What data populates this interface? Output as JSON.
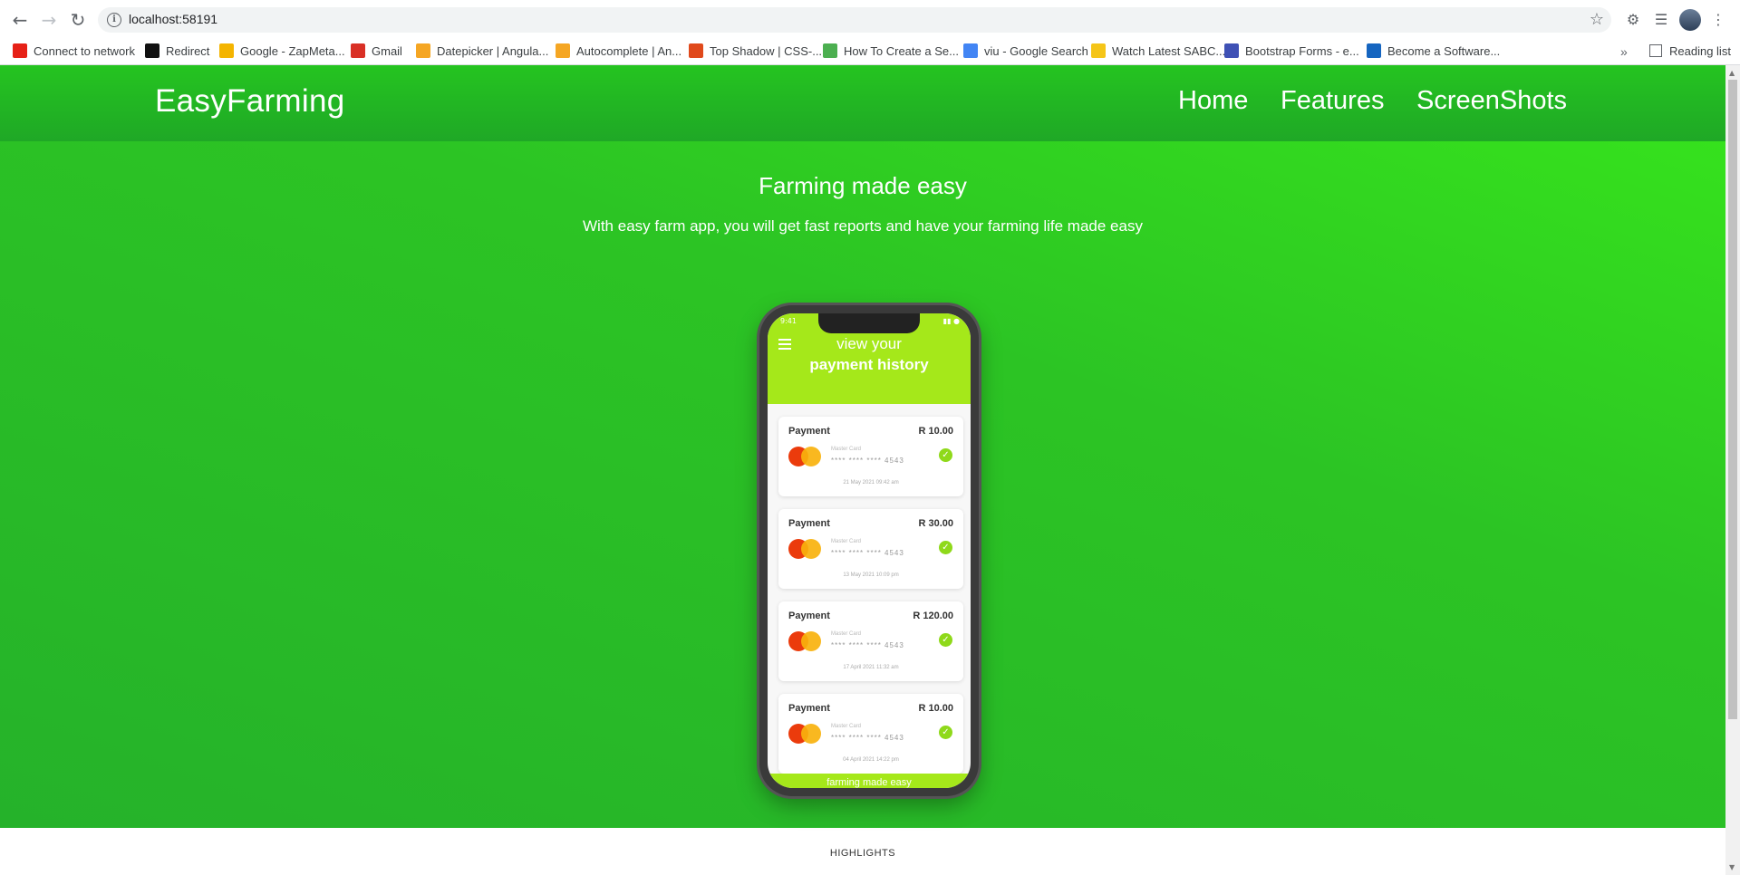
{
  "browser": {
    "url": "localhost:58191",
    "bookmarks": [
      {
        "label": "Connect to network",
        "color": "#e62117"
      },
      {
        "label": "Redirect",
        "color": "#111111"
      },
      {
        "label": "Google - ZapMeta...",
        "color": "#f4b400"
      },
      {
        "label": "Gmail",
        "color": "#d93025"
      },
      {
        "label": "Datepicker | Angula...",
        "color": "#f5a623"
      },
      {
        "label": "Autocomplete | An...",
        "color": "#f5a623"
      },
      {
        "label": "Top Shadow | CSS-...",
        "color": "#e0491b"
      },
      {
        "label": "How To Create a Se...",
        "color": "#4caf50"
      },
      {
        "label": "viu - Google Search",
        "color": "#4285f4"
      },
      {
        "label": "Watch Latest SABC...",
        "color": "#f5c518"
      },
      {
        "label": "Bootstrap Forms - e...",
        "color": "#3f51b5"
      },
      {
        "label": "Become a Software...",
        "color": "#1565c0"
      }
    ],
    "more_label": "»",
    "reading_list": "Reading list"
  },
  "navbar": {
    "brand": "EasyFarming",
    "links": [
      "Home",
      "Features",
      "ScreenShots"
    ]
  },
  "hero": {
    "headline": "Farming made easy",
    "subline": "With easy farm app, you will get fast reports and have your farming life made easy"
  },
  "phone": {
    "status_time": "9:41",
    "title_line1": "view your",
    "title_line2": "payment history",
    "footer": "farming made easy",
    "payments": [
      {
        "label": "Payment",
        "amount": "R 10.00",
        "card_type": "Master Card",
        "card_num": "****  ****  ****  4543",
        "date": "21 May 2021 09:42 am"
      },
      {
        "label": "Payment",
        "amount": "R 30.00",
        "card_type": "Master Card",
        "card_num": "****  ****  ****  4543",
        "date": "13 May 2021 10:09 pm"
      },
      {
        "label": "Payment",
        "amount": "R 120.00",
        "card_type": "Master Card",
        "card_num": "****  ****  ****  4543",
        "date": "17 April 2021 11:32 am"
      },
      {
        "label": "Payment",
        "amount": "R 10.00",
        "card_type": "Master Card",
        "card_num": "****  ****  ****  4543",
        "date": "04 April 2021 14:22 pm"
      }
    ]
  },
  "section": {
    "highlights": "HIGHLIGHTS"
  }
}
